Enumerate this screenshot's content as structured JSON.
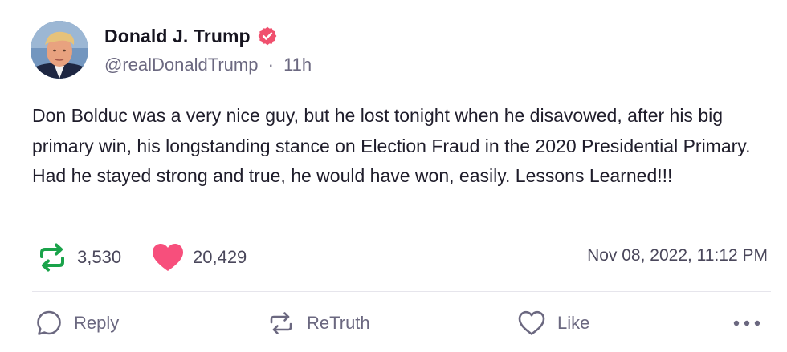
{
  "post": {
    "author_name": "Donald J. Trump",
    "handle": "@realDonaldTrump",
    "separator": "·",
    "time_ago": "11h",
    "text": "Don Bolduc was a very nice guy, but he lost tonight when he disavowed, after his big primary win, his longstanding stance on Election Fraud in the 2020 Presidential Primary. Had he stayed strong and true, he would have won, easily. Lessons Learned!!!",
    "retruth_count": "3,530",
    "like_count": "20,429",
    "timestamp": "Nov 08, 2022, 11:12 PM"
  },
  "actions": {
    "reply_label": "Reply",
    "retruth_label": "ReTruth",
    "like_label": "Like"
  },
  "icons": {
    "verified": "verified-badge-icon",
    "retruth_stat": "retruth-icon",
    "like_stat": "heart-icon",
    "reply": "comment-icon",
    "retruth": "retruth-icon",
    "like": "heart-outline-icon",
    "more": "more-dots-icon"
  },
  "colors": {
    "verified": "#f0506e",
    "retruth_green": "#1aa34a",
    "heart_pink": "#f74f7c",
    "text": "#1f1d2b",
    "muted": "#6b6880"
  }
}
